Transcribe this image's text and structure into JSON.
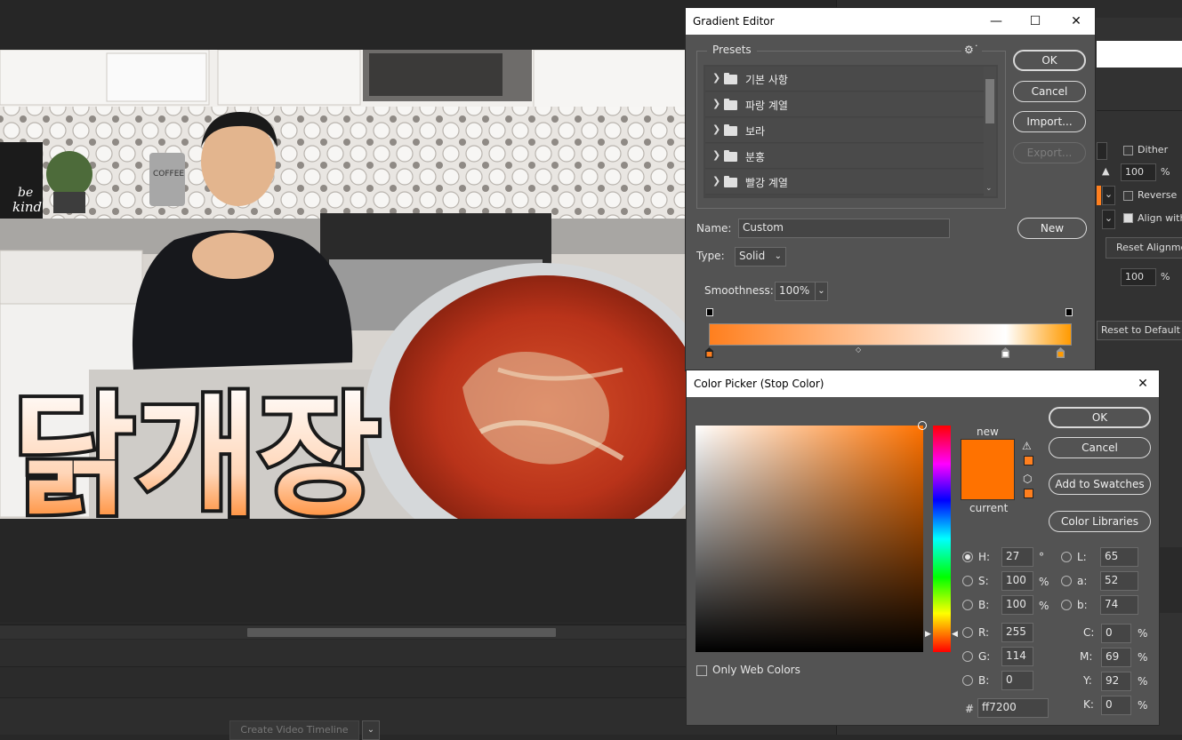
{
  "workspace": {
    "timeline_button": "Create Video Timeline",
    "right_panel": {
      "dither_label": "Dither",
      "reverse_label": "Reverse",
      "align_label": "Align with",
      "opacity_value": "100",
      "scale_value": "100",
      "percent": "%",
      "reset_alignment": "Reset Alignment",
      "reset_default": "Reset to Default",
      "swatch_color": "#ff7f1e"
    },
    "image_text": "닭개장",
    "image_labels": {
      "canister": "COFFEE",
      "sign_line1": "be",
      "sign_line2": "kind"
    }
  },
  "gradient_editor": {
    "title": "Gradient Editor",
    "presets_label": "Presets",
    "presets": [
      {
        "label": "기본 사항"
      },
      {
        "label": "파랑 계열"
      },
      {
        "label": "보라"
      },
      {
        "label": "분홍"
      },
      {
        "label": "빨강 계열"
      }
    ],
    "buttons": {
      "ok": "OK",
      "cancel": "Cancel",
      "import": "Import...",
      "export": "Export...",
      "new": "New"
    },
    "name_label": "Name:",
    "name_value": "Custom",
    "type_label": "Type:",
    "type_value": "Solid",
    "smoothness_label": "Smoothness:",
    "smoothness_value": "100%",
    "gradient": {
      "start_color": "#ff7f1e",
      "mid_color": "#ffffff",
      "end_color": "#ff9a00"
    }
  },
  "color_picker": {
    "title": "Color Picker (Stop Color)",
    "buttons": {
      "ok": "OK",
      "cancel": "Cancel",
      "add_to_swatches": "Add to Swatches",
      "color_libraries": "Color Libraries"
    },
    "new_label": "new",
    "current_label": "current",
    "new_color": "#ff7200",
    "current_color": "#ff7200",
    "only_web_colors": "Only Web Colors",
    "hsb": [
      {
        "label": "H:",
        "value": "27",
        "unit": "°"
      },
      {
        "label": "S:",
        "value": "100",
        "unit": "%"
      },
      {
        "label": "B:",
        "value": "100",
        "unit": "%"
      }
    ],
    "rgb": [
      {
        "label": "R:",
        "value": "255"
      },
      {
        "label": "G:",
        "value": "114"
      },
      {
        "label": "B:",
        "value": "0"
      }
    ],
    "lab": [
      {
        "label": "L:",
        "value": "65"
      },
      {
        "label": "a:",
        "value": "52"
      },
      {
        "label": "b:",
        "value": "74"
      }
    ],
    "cmyk": [
      {
        "label": "C:",
        "value": "0",
        "unit": "%"
      },
      {
        "label": "M:",
        "value": "69",
        "unit": "%"
      },
      {
        "label": "Y:",
        "value": "92",
        "unit": "%"
      },
      {
        "label": "K:",
        "value": "0",
        "unit": "%"
      }
    ],
    "hex_label": "#",
    "hex_value": "ff7200"
  }
}
